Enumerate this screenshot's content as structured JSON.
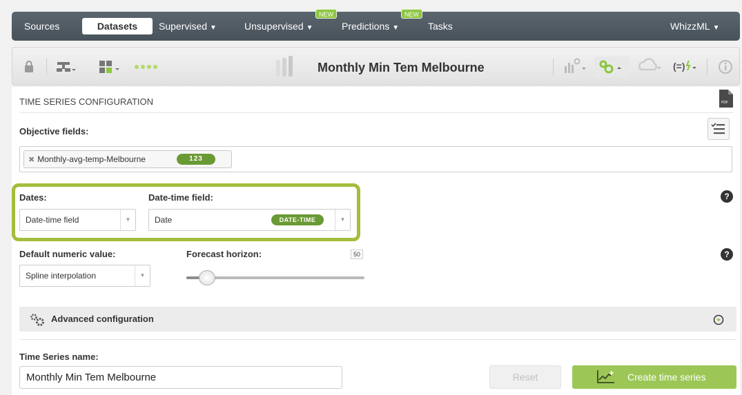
{
  "nav": {
    "items": [
      {
        "label": "Sources"
      },
      {
        "label": "Datasets"
      },
      {
        "label": "Supervised"
      },
      {
        "label": "Unsupervised"
      },
      {
        "label": "Predictions"
      },
      {
        "label": "Tasks"
      }
    ],
    "new_badge": "NEW",
    "right_label": "WhizzML"
  },
  "toolbar": {
    "title": "Monthly Min Tem Melbourne"
  },
  "config": {
    "section_title": "TIME SERIES CONFIGURATION",
    "objective_label": "Objective fields:",
    "objective_field": "Monthly-avg-temp-Melbourne",
    "objective_type": "123",
    "dates_label": "Dates:",
    "dates_value": "Date-time field",
    "datetime_label": "Date-time field:",
    "datetime_value": "Date",
    "datetime_type": "DATE-TIME",
    "default_numeric_label": "Default numeric value:",
    "default_numeric_value": "Spline interpolation",
    "horizon_label": "Forecast horizon:",
    "horizon_value": "50",
    "advanced_label": "Advanced configuration",
    "name_label": "Time Series name:",
    "name_value": "Monthly Min Tem Melbourne",
    "reset_label": "Reset",
    "create_label": "Create time series"
  }
}
